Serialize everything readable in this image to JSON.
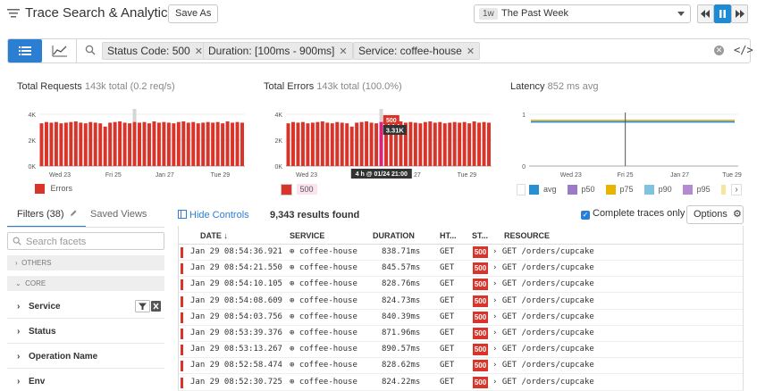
{
  "header": {
    "title": "Trace Search & Analytics",
    "save_as": "Save As",
    "time_tag": "1w",
    "time_value": "The Past Week"
  },
  "search": {
    "chips": [
      "Status Code: 500",
      "Duration: [100ms - 900ms]",
      "Service: coffee-house"
    ],
    "code_toggle": "</>"
  },
  "charts": {
    "requests": {
      "title": "Total Requests",
      "sub": "143k total (0.2 req/s)",
      "legend": "Errors"
    },
    "errors": {
      "title": "Total Errors",
      "sub": "143k total (100.0%)",
      "legend": "500",
      "tooltip_value": "3.31K",
      "tooltip_label": "500",
      "hover_time": "4 h @ 01/24 21:00"
    },
    "latency": {
      "title": "Latency",
      "sub": "852 ms avg",
      "legend": [
        "avg",
        "p50",
        "p75",
        "p90",
        "p95"
      ]
    }
  },
  "chart_data": [
    {
      "type": "bar",
      "title": "Total Requests",
      "ylim": [
        0,
        4000
      ],
      "yticks": [
        "4K",
        "2K",
        "0K"
      ],
      "xticks": [
        "Wed 23",
        "Fri 25",
        "Jan 27",
        "Tue 29"
      ],
      "series": [
        {
          "name": "Errors",
          "values": [
            3300,
            3400,
            3350,
            3400,
            3300,
            3350,
            3400,
            3450,
            3350,
            3300,
            3400,
            3350,
            3300,
            3050,
            3350,
            3400,
            3450,
            3350,
            3300,
            3400,
            3350,
            3400,
            3300,
            3450,
            3350,
            3400,
            3350,
            3300,
            3400,
            3450,
            3350,
            3400,
            3300,
            3350,
            3400,
            3350,
            3400,
            3300,
            3450,
            3350,
            3400,
            3350
          ]
        }
      ],
      "color": "#d9342a"
    },
    {
      "type": "bar",
      "title": "Total Errors",
      "ylim": [
        0,
        4000
      ],
      "yticks": [
        "4K",
        "2K",
        "0K"
      ],
      "xticks": [
        "Wed 23",
        "Fri 25",
        "Jan 27",
        "Tue 29"
      ],
      "series": [
        {
          "name": "500",
          "values": [
            3300,
            3400,
            3350,
            3400,
            3300,
            3350,
            3400,
            3450,
            3350,
            3300,
            3400,
            3350,
            3300,
            3050,
            3350,
            3400,
            3450,
            3350,
            3300,
            3400,
            3350,
            3400,
            3300,
            3450,
            3350,
            3400,
            3350,
            3300,
            3400,
            3450,
            3350,
            3400,
            3300,
            3350,
            3400,
            3350,
            3400,
            3300,
            3450,
            3350,
            3400,
            3350
          ]
        }
      ],
      "color": "#d9342a"
    },
    {
      "type": "line",
      "title": "Latency",
      "ylim": [
        0,
        1
      ],
      "yticks": [
        "1",
        "0"
      ],
      "xticks": [
        "Wed 23",
        "Fri 25",
        "Jan 27",
        "Tue 29"
      ],
      "series": [
        {
          "name": "p95",
          "values": [
            0.89,
            0.89
          ],
          "color": "#f5e5a0"
        },
        {
          "name": "p90",
          "values": [
            0.88,
            0.88
          ],
          "color": "#7fc3e0"
        },
        {
          "name": "p75",
          "values": [
            0.87,
            0.87
          ],
          "color": "#e8b400"
        },
        {
          "name": "p50",
          "values": [
            0.85,
            0.85
          ],
          "color": "#9b7bc7"
        },
        {
          "name": "avg",
          "values": [
            0.852,
            0.852
          ],
          "color": "#2a8fd0"
        }
      ]
    }
  ],
  "filters": {
    "tab_filters": "Filters (38)",
    "tab_saved": "Saved Views",
    "search_placeholder": "Search facets",
    "groups": [
      "OTHERS",
      "CORE"
    ],
    "facets": [
      "Service",
      "Status",
      "Operation Name",
      "Env"
    ]
  },
  "results": {
    "hide_controls": "Hide Controls",
    "count": "9,343 results found",
    "complete_traces": "Complete traces only",
    "options": "Options",
    "columns": [
      "DATE ↓",
      "SERVICE",
      "DURATION",
      "HT...",
      "ST...",
      "RESOURCE"
    ],
    "rows": [
      {
        "date": "Jan 29 08:54:36.921",
        "service": "coffee-house",
        "duration": "838.71ms",
        "method": "GET",
        "status": "500",
        "resource": "GET /orders/cupcake"
      },
      {
        "date": "Jan 29 08:54:21.550",
        "service": "coffee-house",
        "duration": "845.57ms",
        "method": "GET",
        "status": "500",
        "resource": "GET /orders/cupcake"
      },
      {
        "date": "Jan 29 08:54:10.105",
        "service": "coffee-house",
        "duration": "828.76ms",
        "method": "GET",
        "status": "500",
        "resource": "GET /orders/cupcake"
      },
      {
        "date": "Jan 29 08:54:08.609",
        "service": "coffee-house",
        "duration": "824.73ms",
        "method": "GET",
        "status": "500",
        "resource": "GET /orders/cupcake"
      },
      {
        "date": "Jan 29 08:54:03.756",
        "service": "coffee-house",
        "duration": "840.39ms",
        "method": "GET",
        "status": "500",
        "resource": "GET /orders/cupcake"
      },
      {
        "date": "Jan 29 08:53:39.376",
        "service": "coffee-house",
        "duration": "871.96ms",
        "method": "GET",
        "status": "500",
        "resource": "GET /orders/cupcake"
      },
      {
        "date": "Jan 29 08:53:13.267",
        "service": "coffee-house",
        "duration": "890.57ms",
        "method": "GET",
        "status": "500",
        "resource": "GET /orders/cupcake"
      },
      {
        "date": "Jan 29 08:52:58.474",
        "service": "coffee-house",
        "duration": "828.62ms",
        "method": "GET",
        "status": "500",
        "resource": "GET /orders/cupcake"
      },
      {
        "date": "Jan 29 08:52:30.725",
        "service": "coffee-house",
        "duration": "824.22ms",
        "method": "GET",
        "status": "500",
        "resource": "GET /orders/cupcake"
      }
    ]
  }
}
